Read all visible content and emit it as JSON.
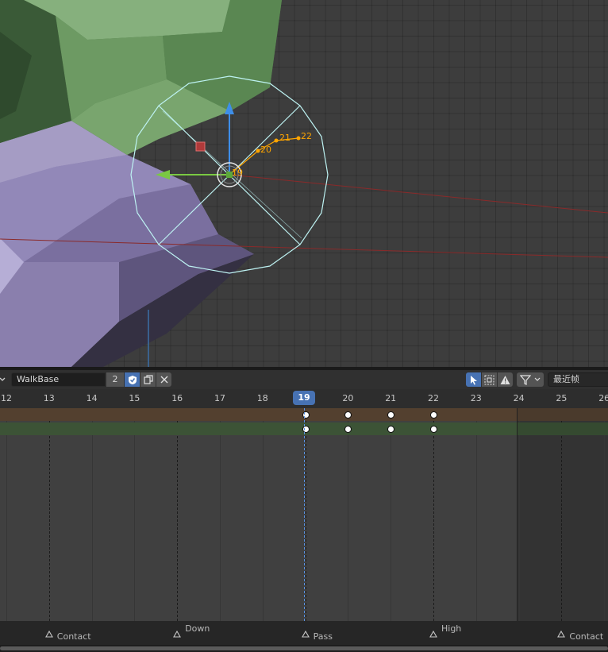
{
  "viewport": {
    "motion_path_labels": [
      "19",
      "20",
      "21",
      "22"
    ]
  },
  "action_editor": {
    "action_name": "WalkBase",
    "user_count": "2",
    "snapping": "最近帧",
    "current_frame": "19",
    "ruler_numbers": [
      "12",
      "13",
      "14",
      "15",
      "16",
      "17",
      "18",
      "19",
      "20",
      "21",
      "22",
      "23",
      "24",
      "25",
      "26"
    ],
    "markers": [
      {
        "name": "Contact",
        "frame": 13
      },
      {
        "name": "Down",
        "frame": 16
      },
      {
        "name": "Pass",
        "frame": 19
      },
      {
        "name": "High",
        "frame": 22
      },
      {
        "name": "Contact",
        "frame": 25
      }
    ],
    "keyframes": [
      19,
      20,
      21,
      22
    ],
    "frame_end": 24
  },
  "colors": {
    "accent": "#4772b3",
    "summary_row": "#53402f",
    "object_row": "#3c5336",
    "motion_path": "#ffa500",
    "bone_wire": "#bdf2f2"
  }
}
